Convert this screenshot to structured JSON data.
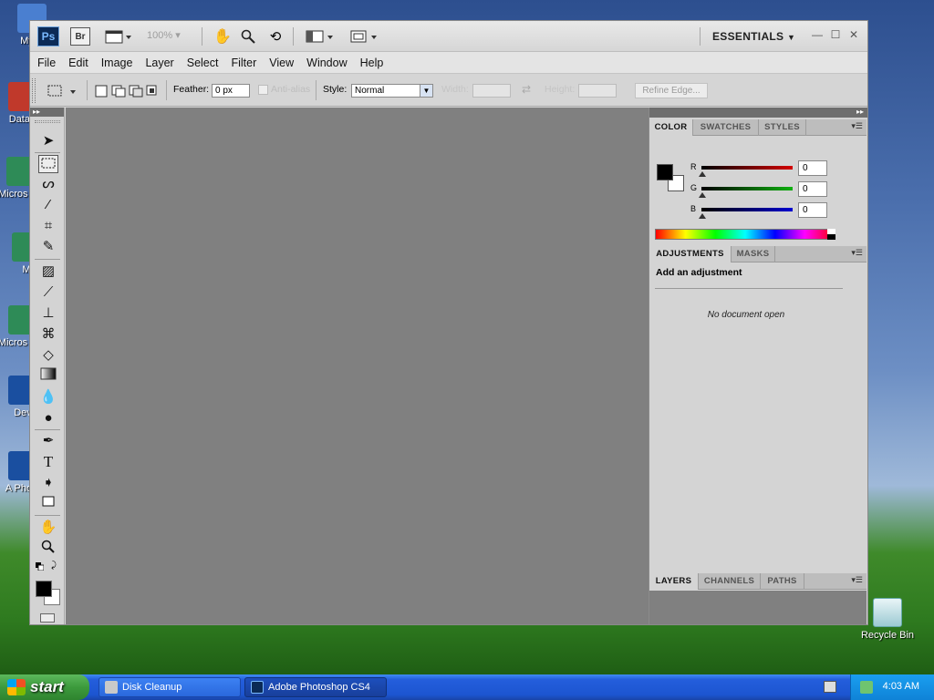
{
  "desktop": {
    "icons": [
      {
        "label": "My C",
        "color": "#4a7fd0"
      },
      {
        "label": "DataV",
        "color": "#c0392b"
      },
      {
        "label": "Micros C+",
        "color": "#2e8b57"
      },
      {
        "label": "M",
        "color": "#2e8b57"
      },
      {
        "label": "Micros Bas",
        "color": "#2e8b57"
      },
      {
        "label": "Dev",
        "color": "#1a4fa0"
      },
      {
        "label": "A Photo",
        "color": "#1a4fa0"
      }
    ],
    "recycle_bin": "Recycle Bin"
  },
  "app": {
    "logo": "Ps",
    "bridge": "Br",
    "zoom": "100%",
    "workspace": "ESSENTIALS",
    "menu": [
      "File",
      "Edit",
      "Image",
      "Layer",
      "Select",
      "Filter",
      "View",
      "Window",
      "Help"
    ]
  },
  "options": {
    "feather_label": "Feather:",
    "feather_value": "0 px",
    "antialias_label": "Anti-alias",
    "style_label": "Style:",
    "style_value": "Normal",
    "width_label": "Width:",
    "height_label": "Height:",
    "refine_edge": "Refine Edge..."
  },
  "panels": {
    "color_tabs": [
      "COLOR",
      "SWATCHES",
      "STYLES"
    ],
    "channels": [
      {
        "label": "R",
        "value": "0",
        "color": "#d40000"
      },
      {
        "label": "G",
        "value": "0",
        "color": "#10b010"
      },
      {
        "label": "B",
        "value": "0",
        "color": "#0000d0"
      }
    ],
    "adjust_tabs": [
      "ADJUSTMENTS",
      "MASKS"
    ],
    "add_adjustment": "Add an adjustment",
    "no_document": "No document open",
    "layers_tabs": [
      "LAYERS",
      "CHANNELS",
      "PATHS"
    ]
  },
  "taskbar": {
    "start": "start",
    "tasks": [
      "Disk Cleanup",
      "Adobe Photoshop CS4"
    ],
    "clock": "4:03 AM"
  }
}
